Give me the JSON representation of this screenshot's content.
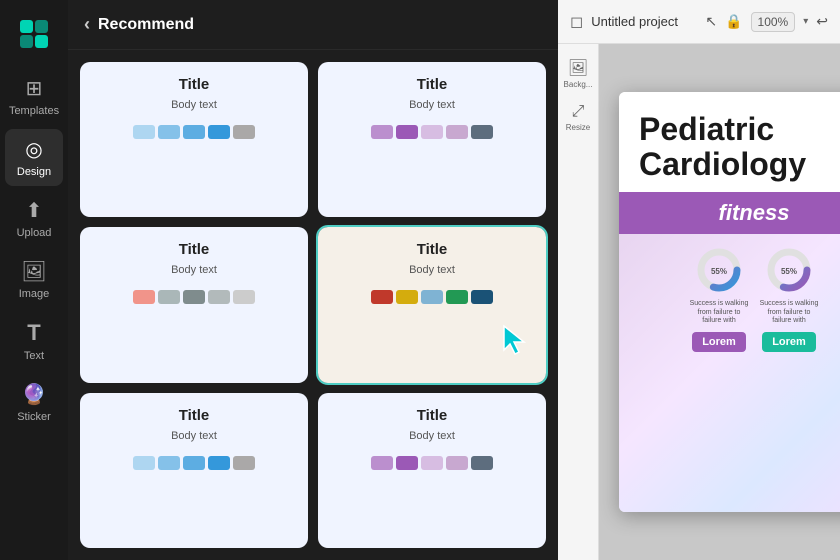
{
  "leftSidebar": {
    "items": [
      {
        "id": "templates",
        "label": "Templates",
        "icon": "⊞",
        "active": false
      },
      {
        "id": "design",
        "label": "Design",
        "icon": "◎",
        "active": true
      },
      {
        "id": "upload",
        "label": "Upload",
        "icon": "⬆",
        "active": false
      },
      {
        "id": "image",
        "label": "Image",
        "icon": "🖼",
        "active": false
      },
      {
        "id": "text",
        "label": "Text",
        "icon": "T",
        "active": false
      },
      {
        "id": "sticker",
        "label": "Sticker",
        "icon": "🔮",
        "active": false
      }
    ]
  },
  "panel": {
    "backLabel": "‹",
    "title": "Recommend",
    "cards": [
      {
        "id": "card-1",
        "title": "Title",
        "body": "Body text",
        "variant": "light-blue",
        "swatches": [
          "#aed6f1",
          "#85c1e9",
          "#5dade2",
          "#3498db",
          "#aaa8a8"
        ]
      },
      {
        "id": "card-2",
        "title": "Title",
        "body": "Body text",
        "variant": "purple",
        "swatches": [
          "#bb8fce",
          "#9b59b6",
          "#d7bde2",
          "#c39bd3",
          "#5d6d7e"
        ]
      },
      {
        "id": "card-3",
        "title": "Title",
        "body": "Body text",
        "variant": "light-blue",
        "swatches": [
          "#f1948a",
          "#e59866",
          "#aab7b8",
          "#7f8c8d",
          "#b2babb"
        ]
      },
      {
        "id": "card-4",
        "title": "Title",
        "body": "Body text",
        "variant": "warm",
        "swatches": [
          "#c0392b",
          "#d4ac0d",
          "#7fb3d3",
          "#229954",
          "#1a5276"
        ],
        "selected": true,
        "hasCursor": true
      },
      {
        "id": "card-5",
        "title": "Title",
        "body": "Body text",
        "variant": "light-blue",
        "swatches": [
          "#aed6f1",
          "#85c1e9",
          "#5dade2",
          "#3498db",
          "#aaa8a8"
        ]
      },
      {
        "id": "card-6",
        "title": "Title",
        "body": "Body text",
        "variant": "purple",
        "swatches": [
          "#bb8fce",
          "#9b59b6",
          "#d7bde2",
          "#c39bd3",
          "#5d6d7e"
        ]
      }
    ]
  },
  "canvas": {
    "projectIcon": "◻",
    "projectTitle": "Untitled project",
    "zoom": "100%",
    "floatingPanel": [
      {
        "id": "background",
        "icon": "🖼",
        "label": "Backg..."
      },
      {
        "id": "resize",
        "icon": "⤢",
        "label": "Resize"
      }
    ],
    "slide": {
      "heading": "Pediatric\nCardiology",
      "subheading": "fitness",
      "chartPercent1": "55%",
      "chartPercent2": "55%",
      "chartCaption1": "Success is walking from failure to failure with",
      "chartCaption2": "Success is walking from failure to failure with",
      "loremBtn1": "Lorem",
      "loremBtn2": "Lorem"
    }
  }
}
